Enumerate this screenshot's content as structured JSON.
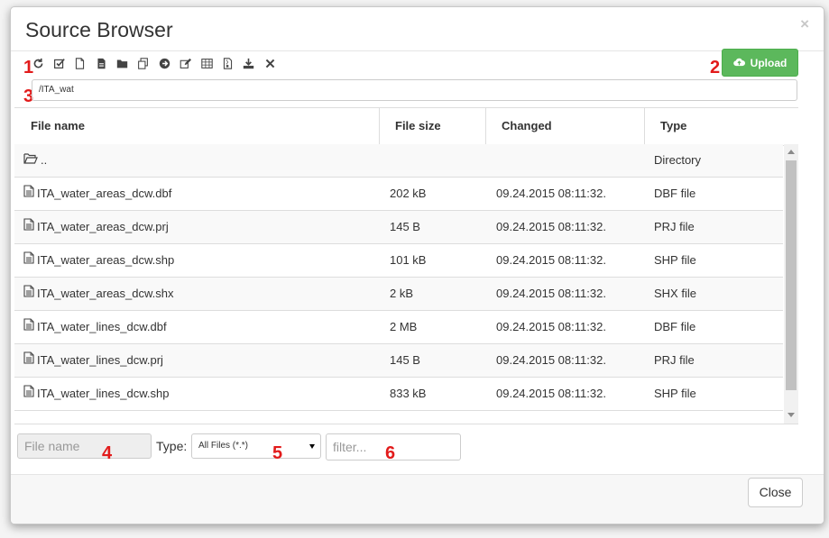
{
  "dialog": {
    "title": "Source Browser",
    "close_symbol": "×"
  },
  "callouts": [
    "1",
    "2",
    "3",
    "4",
    "5",
    "6"
  ],
  "toolbar": {
    "icons": [
      "refresh-icon",
      "select-all-icon",
      "new-file-icon",
      "file-text-icon",
      "folder-icon",
      "copy-icon",
      "go-icon",
      "edit-icon",
      "table-icon",
      "compress-icon",
      "download-icon",
      "delete-icon"
    ],
    "upload_label": "Upload",
    "upload_icon": "cloud-upload-icon",
    "upload_color": "#5cb85c"
  },
  "path": {
    "value": "/ITA_wat"
  },
  "table": {
    "headers": [
      "File name",
      "File size",
      "Changed",
      "Type"
    ],
    "parent_row": {
      "name": "..",
      "type": "Directory",
      "icon": "folder-open-icon"
    },
    "rows": [
      {
        "name": "ITA_water_areas_dcw.dbf",
        "size": "202 kB",
        "changed": "09.24.2015 08:11:32.",
        "type": "DBF file"
      },
      {
        "name": "ITA_water_areas_dcw.prj",
        "size": "145 B",
        "changed": "09.24.2015 08:11:32.",
        "type": "PRJ file"
      },
      {
        "name": "ITA_water_areas_dcw.shp",
        "size": "101 kB",
        "changed": "09.24.2015 08:11:32.",
        "type": "SHP file"
      },
      {
        "name": "ITA_water_areas_dcw.shx",
        "size": "2 kB",
        "changed": "09.24.2015 08:11:32.",
        "type": "SHX file"
      },
      {
        "name": "ITA_water_lines_dcw.dbf",
        "size": "2 MB",
        "changed": "09.24.2015 08:11:32.",
        "type": "DBF file"
      },
      {
        "name": "ITA_water_lines_dcw.prj",
        "size": "145 B",
        "changed": "09.24.2015 08:11:32.",
        "type": "PRJ file"
      },
      {
        "name": "ITA_water_lines_dcw.shp",
        "size": "833 kB",
        "changed": "09.24.2015 08:11:32.",
        "type": "SHP file"
      }
    ]
  },
  "footer": {
    "file_name_placeholder": "File name",
    "type_label": "Type:",
    "type_selected": "All Files (*.*)",
    "filter_placeholder": "filter...",
    "close_label": "Close"
  }
}
